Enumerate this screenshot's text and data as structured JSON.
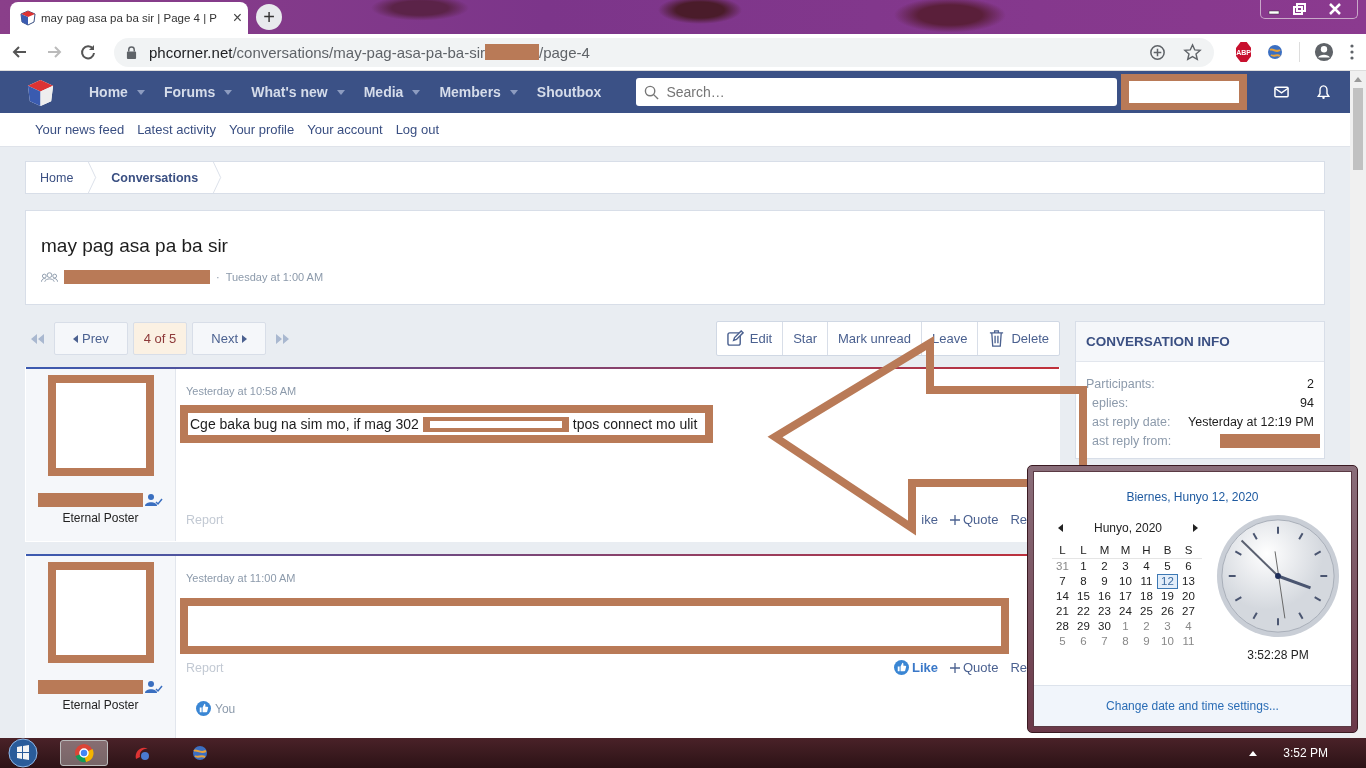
{
  "browser": {
    "tab": {
      "title": "may pag asa pa ba sir | Page 4 | P",
      "close": "×"
    },
    "new_tab": "+",
    "url": {
      "host": "phcorner.net",
      "path": "/conversations/may-pag-asa-pa-ba-sir",
      "path_end": "/page-4"
    },
    "adblock_badge": "ABP"
  },
  "nav": {
    "items": [
      {
        "label": "Home",
        "dropdown": true
      },
      {
        "label": "Forums",
        "dropdown": true
      },
      {
        "label": "What's new",
        "dropdown": true
      },
      {
        "label": "Media",
        "dropdown": true
      },
      {
        "label": "Members",
        "dropdown": true
      },
      {
        "label": "Shoutbox",
        "dropdown": false
      }
    ],
    "search": {
      "placeholder": "Search…"
    }
  },
  "subnav": [
    "Your news feed",
    "Latest activity",
    "Your profile",
    "Your account",
    "Log out"
  ],
  "breadcrumbs": [
    {
      "label": "Home",
      "current": false
    },
    {
      "label": "Conversations",
      "current": true
    }
  ],
  "thread": {
    "title": "may pag asa pa ba sir",
    "separator": "·",
    "started": "Tuesday at 1:00 AM"
  },
  "pagination": {
    "prev": "Prev",
    "pages": "4 of 5",
    "next": "Next"
  },
  "actions": [
    {
      "label": "Edit",
      "kind": "edit"
    },
    {
      "label": "Star",
      "kind": "plain"
    },
    {
      "label": "Mark unread",
      "kind": "plain"
    },
    {
      "label": "Leave",
      "kind": "plain"
    },
    {
      "label": "Delete",
      "kind": "delete"
    }
  ],
  "sidebar": {
    "title": "CONVERSATION INFO",
    "rows": [
      {
        "label": "Participants:",
        "value": "2"
      },
      {
        "label": "eplies:",
        "value": "94"
      },
      {
        "label": "ast reply date:",
        "value": "Yesterday at 12:19 PM"
      },
      {
        "label": "ast reply from:",
        "redacted": true
      }
    ]
  },
  "messages": [
    {
      "time": "Yesterday at 10:58 AM",
      "user_title": "Eternal Poster",
      "body": [
        "Cge baka bug na sim mo, if mag 302",
        "tpos connect mo ulit"
      ],
      "report": "Report",
      "like": {
        "label": "ike",
        "liked": false
      },
      "quote": "Quote",
      "reply": "Re"
    },
    {
      "time": "Yesterday at 11:00 AM",
      "user_title": "Eternal Poster",
      "report": "Report",
      "like": {
        "label": "Like",
        "liked": true
      },
      "quote": "Quote",
      "reply": "Re",
      "reaction": "You"
    }
  ],
  "calendar": {
    "heading": "Biernes, Hunyo 12, 2020",
    "month": "Hunyo, 2020",
    "weekdays": [
      "L",
      "L",
      "M",
      "M",
      "H",
      "B",
      "S"
    ],
    "weeks": [
      [
        {
          "day": "31",
          "outside": true,
          "selected": false
        },
        {
          "day": "1",
          "outside": false,
          "selected": false
        },
        {
          "day": "2",
          "outside": false,
          "selected": false
        },
        {
          "day": "3",
          "outside": false,
          "selected": false
        },
        {
          "day": "4",
          "outside": false,
          "selected": false
        },
        {
          "day": "5",
          "outside": false,
          "selected": false
        },
        {
          "day": "6",
          "outside": false,
          "selected": false
        }
      ],
      [
        {
          "day": "7",
          "outside": false,
          "selected": false
        },
        {
          "day": "8",
          "outside": false,
          "selected": false
        },
        {
          "day": "9",
          "outside": false,
          "selected": false
        },
        {
          "day": "10",
          "outside": false,
          "selected": false
        },
        {
          "day": "11",
          "outside": false,
          "selected": false
        },
        {
          "day": "12",
          "outside": false,
          "selected": true
        },
        {
          "day": "13",
          "outside": false,
          "selected": false
        }
      ],
      [
        {
          "day": "14",
          "outside": false,
          "selected": false
        },
        {
          "day": "15",
          "outside": false,
          "selected": false
        },
        {
          "day": "16",
          "outside": false,
          "selected": false
        },
        {
          "day": "17",
          "outside": false,
          "selected": false
        },
        {
          "day": "18",
          "outside": false,
          "selected": false
        },
        {
          "day": "19",
          "outside": false,
          "selected": false
        },
        {
          "day": "20",
          "outside": false,
          "selected": false
        }
      ],
      [
        {
          "day": "21",
          "outside": false,
          "selected": false
        },
        {
          "day": "22",
          "outside": false,
          "selected": false
        },
        {
          "day": "23",
          "outside": false,
          "selected": false
        },
        {
          "day": "24",
          "outside": false,
          "selected": false
        },
        {
          "day": "25",
          "outside": false,
          "selected": false
        },
        {
          "day": "26",
          "outside": false,
          "selected": false
        },
        {
          "day": "27",
          "outside": false,
          "selected": false
        }
      ],
      [
        {
          "day": "28",
          "outside": false,
          "selected": false
        },
        {
          "day": "29",
          "outside": false,
          "selected": false
        },
        {
          "day": "30",
          "outside": false,
          "selected": false
        },
        {
          "day": "1",
          "outside": true,
          "selected": false
        },
        {
          "day": "2",
          "outside": true,
          "selected": false
        },
        {
          "day": "3",
          "outside": true,
          "selected": false
        },
        {
          "day": "4",
          "outside": true,
          "selected": false
        }
      ],
      [
        {
          "day": "5",
          "outside": true,
          "selected": false
        },
        {
          "day": "6",
          "outside": true,
          "selected": false
        },
        {
          "day": "7",
          "outside": true,
          "selected": false
        },
        {
          "day": "8",
          "outside": true,
          "selected": false
        },
        {
          "day": "9",
          "outside": true,
          "selected": false
        },
        {
          "day": "10",
          "outside": true,
          "selected": false
        },
        {
          "day": "11",
          "outside": true,
          "selected": false
        }
      ]
    ],
    "time": "3:52:28 PM",
    "settings_link": "Change date and time settings..."
  },
  "taskbar": {
    "time": "3:52 PM"
  }
}
